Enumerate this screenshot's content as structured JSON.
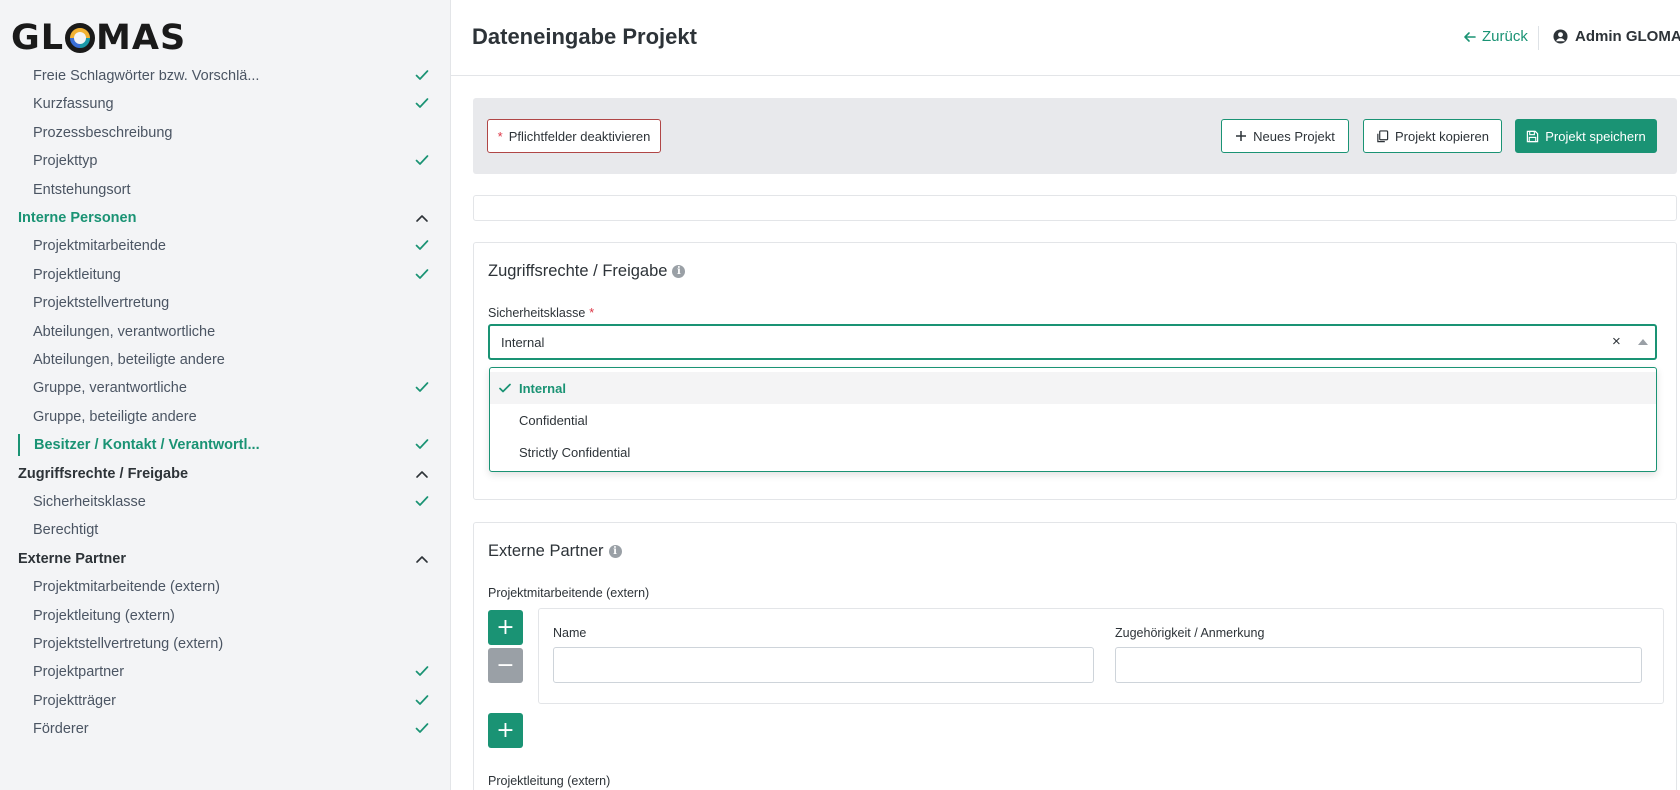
{
  "app": {
    "logo_text_left": "GL",
    "logo_text_right": "MAS"
  },
  "header": {
    "title": "Dateneingabe Projekt",
    "back_label": "Zurück",
    "user_name": "Admin GLOMAS"
  },
  "toolbar": {
    "required_toggle_marker": "*",
    "required_toggle_label": "Pflichtfelder deaktivieren",
    "new_project_label": "Neues Projekt",
    "copy_project_label": "Projekt kopieren",
    "save_project_label": "Projekt speichern"
  },
  "sidebar": {
    "items": [
      {
        "label": "Freie Schlagwörter bzw. Vorschlä...",
        "type": "item",
        "checked": true
      },
      {
        "label": "Kurzfassung",
        "type": "item",
        "checked": true
      },
      {
        "label": "Prozessbeschreibung",
        "type": "item",
        "checked": false
      },
      {
        "label": "Projekttyp",
        "type": "item",
        "required": "*",
        "checked": true
      },
      {
        "label": "Entstehungsort",
        "type": "item",
        "checked": false
      },
      {
        "label": "Interne Personen",
        "type": "section",
        "highlight": true
      },
      {
        "label": "Projektmitarbeitende",
        "type": "item",
        "checked": true
      },
      {
        "label": "Projektleitung",
        "type": "item",
        "checked": true
      },
      {
        "label": "Projektstellvertretung",
        "type": "item",
        "checked": false
      },
      {
        "label": "Abteilungen, verantwortliche",
        "type": "item",
        "checked": false
      },
      {
        "label": "Abteilungen, beteiligte andere",
        "type": "item",
        "checked": false
      },
      {
        "label": "Gruppe, verantwortliche",
        "type": "item",
        "required": "*",
        "checked": true
      },
      {
        "label": "Gruppe, beteiligte andere",
        "type": "item",
        "checked": false
      },
      {
        "label": "Besitzer / Kontakt / Verantwortl...",
        "type": "item",
        "required": "*",
        "checked": true,
        "active": true
      },
      {
        "label": "Zugriffsrechte / Freigabe",
        "type": "section"
      },
      {
        "label": "Sicherheitsklasse",
        "type": "item",
        "required": "*",
        "checked": true
      },
      {
        "label": "Berechtigt",
        "type": "item",
        "checked": false
      },
      {
        "label": "Externe Partner",
        "type": "section"
      },
      {
        "label": "Projektmitarbeitende (extern)",
        "type": "item",
        "checked": false
      },
      {
        "label": "Projektleitung (extern)",
        "type": "item",
        "checked": false
      },
      {
        "label": "Projektstellvertretung (extern)",
        "type": "item",
        "checked": false
      },
      {
        "label": "Projektpartner",
        "type": "item",
        "checked": true
      },
      {
        "label": "Projektträger",
        "type": "item",
        "checked": true
      },
      {
        "label": "Förderer",
        "type": "item",
        "checked": true
      }
    ]
  },
  "access": {
    "title": "Zugriffsrechte / Freigabe",
    "security_label": "Sicherheitsklasse",
    "security_required": "*",
    "security_value": "Internal",
    "clear_symbol": "×",
    "options": [
      {
        "label": "Internal",
        "selected": true
      },
      {
        "label": "Confidential",
        "selected": false
      },
      {
        "label": "Strictly Confidential",
        "selected": false
      }
    ]
  },
  "external": {
    "title": "Externe Partner",
    "employees_label": "Projektmitarbeitende (extern)",
    "name_label": "Name",
    "affiliation_label": "Zugehörigkeit / Anmerkung",
    "name_value": "",
    "affiliation_value": "",
    "add_symbol": "+",
    "remove_symbol": "−",
    "leader_label": "Projektleitung (extern)"
  },
  "colors": {
    "accent": "#1a9374",
    "required": "#dc3545",
    "muted": "#9aa0a6"
  }
}
